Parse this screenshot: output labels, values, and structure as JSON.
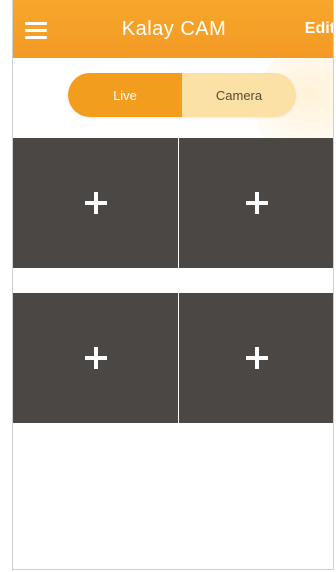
{
  "header": {
    "title": "Kalay CAM",
    "edit_label": "Edit",
    "menu_icon": "hamburger-menu-icon",
    "accent_color": "#f39a25"
  },
  "tabs": [
    {
      "label": "Live",
      "selected": true
    },
    {
      "label": "Camera",
      "selected": false
    }
  ],
  "grid": {
    "rows": 2,
    "columns": 2,
    "slot_icon": "plus-icon",
    "slot_color": "#4a4745"
  }
}
